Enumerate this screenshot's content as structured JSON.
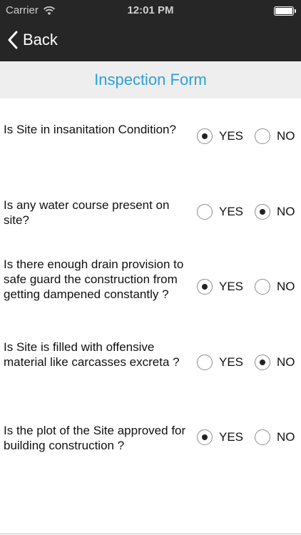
{
  "status_bar": {
    "carrier": "Carrier",
    "time": "12:01 PM"
  },
  "nav": {
    "back_label": "Back"
  },
  "title": "Inspection Form",
  "options": {
    "yes_label": "YES",
    "no_label": "NO"
  },
  "questions": [
    {
      "text": "Is Site in insanitation Condition?",
      "answer": "YES"
    },
    {
      "text": "Is any water course present on site?",
      "answer": "NO"
    },
    {
      "text": "Is there enough drain provision to safe guard the construction from getting dampened constantly ?",
      "answer": "YES"
    },
    {
      "text": "Is Site is filled with offensive material like carcasses excreta ?",
      "answer": "NO"
    },
    {
      "text": "Is the plot of the Site approved for building construction ?",
      "answer": "YES"
    }
  ]
}
